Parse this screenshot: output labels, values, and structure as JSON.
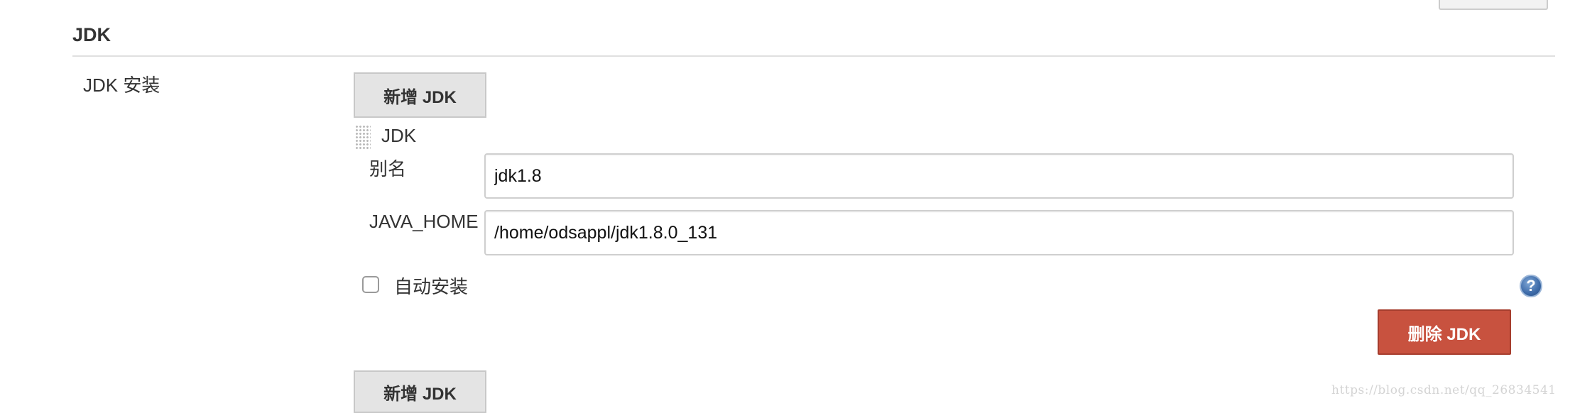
{
  "section": {
    "title": "JDK"
  },
  "jdk": {
    "row_label": "JDK 安装",
    "add_button_label": "新增 JDK",
    "item": {
      "title": "JDK",
      "alias_label": "别名",
      "alias_value": "jdk1.8",
      "java_home_label": "JAVA_HOME",
      "java_home_value": "/home/odsappl/jdk1.8.0_131",
      "auto_install_label": "自动安装",
      "auto_install_checked": false,
      "help_glyph": "?",
      "delete_button_label": "删除 JDK"
    },
    "add_button_bottom_label": "新增 JDK"
  },
  "icons": {
    "drag_handle": "drag-handle-icon",
    "help": "help-icon"
  },
  "colors": {
    "delete_button": "#c8523f",
    "help_icon": "#3c6aa8",
    "button_gray": "#e4e4e4"
  },
  "watermark": "https://blog.csdn.net/qq_26834541"
}
